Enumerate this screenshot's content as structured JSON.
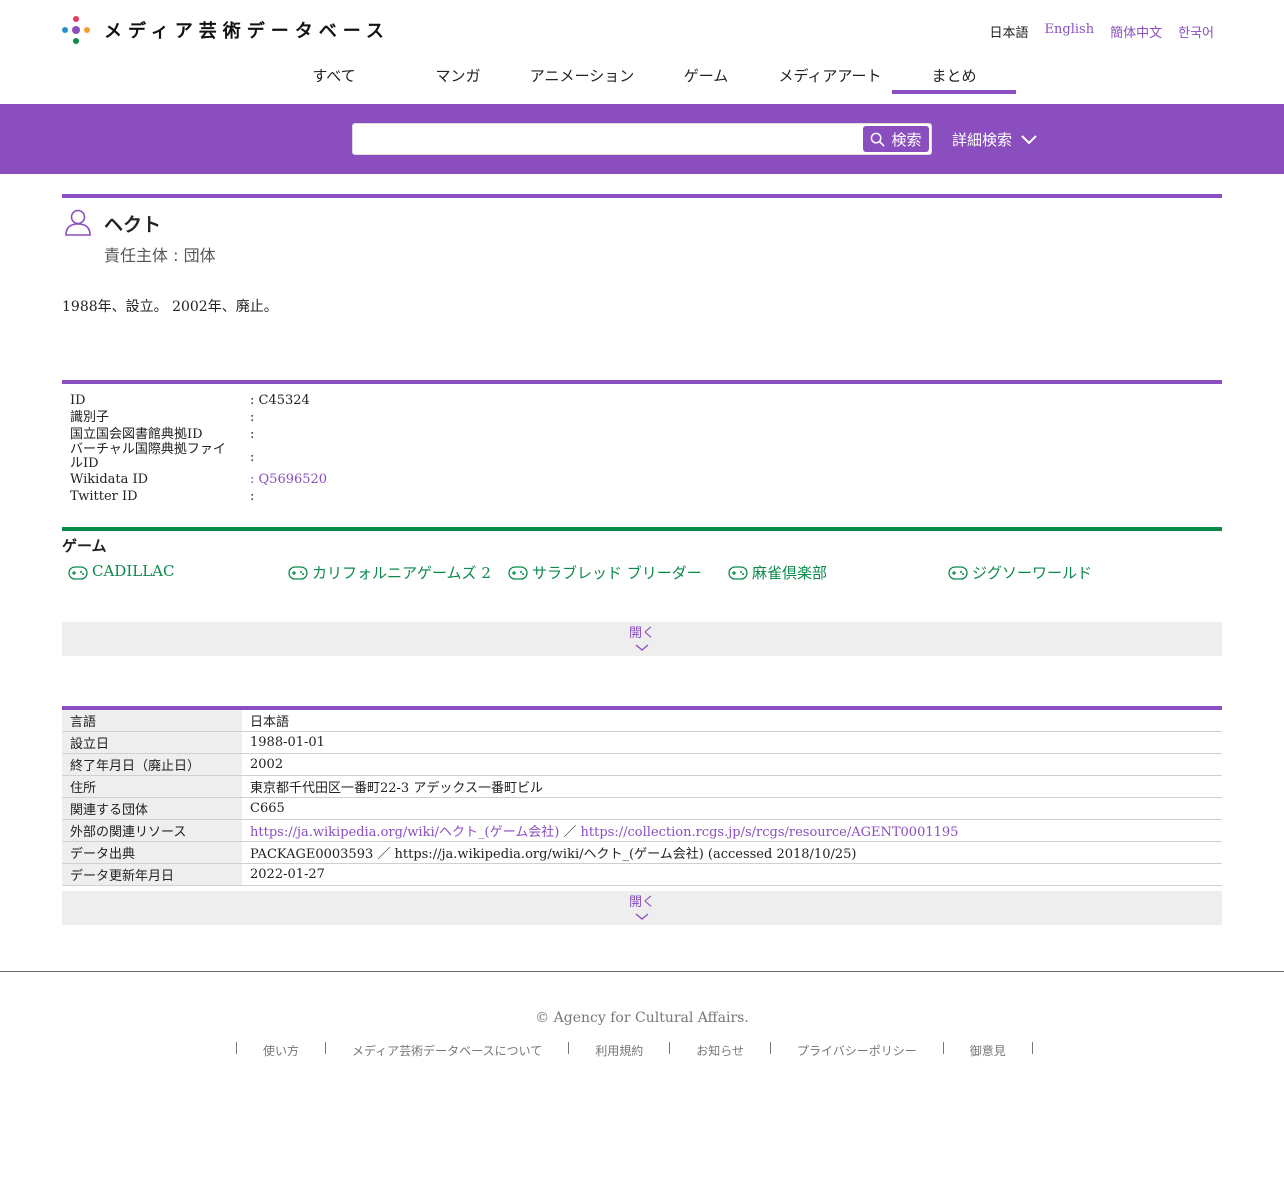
{
  "site": {
    "title": "メディア芸術データベース"
  },
  "languages": [
    {
      "label": "日本語"
    },
    {
      "label": "English"
    },
    {
      "label": "簡体中文"
    },
    {
      "label": "한국어"
    }
  ],
  "nav": [
    {
      "label": "すべて"
    },
    {
      "label": "マンガ"
    },
    {
      "label": "アニメーション"
    },
    {
      "label": "ゲーム"
    },
    {
      "label": "メディアアート"
    },
    {
      "label": "まとめ"
    }
  ],
  "search": {
    "button_label": "検索",
    "advanced_label": "詳細検索",
    "value": ""
  },
  "entity": {
    "name": "ヘクト",
    "type_label": "責任主体 : 団体",
    "description": "1988年、設立。 2002年、廃止。"
  },
  "identifiers": [
    {
      "key": "ID",
      "value": ": C45324"
    },
    {
      "key": "識別子",
      "value": ":"
    },
    {
      "key": "国立国会図書館典拠ID",
      "value": ":"
    },
    {
      "key": "バーチャル国際典拠ファイルID",
      "value": ":"
    },
    {
      "key": "Wikidata ID",
      "value": ": Q5696520"
    },
    {
      "key": "Twitter ID",
      "value": ":"
    }
  ],
  "games": {
    "section_title": "ゲーム",
    "items": [
      {
        "title": "CADILLAC"
      },
      {
        "title": "カリフォルニアゲームズ 2"
      },
      {
        "title": "サラブレッド ブリーダー"
      },
      {
        "title": "麻雀倶楽部"
      },
      {
        "title": "ジグソーワールド"
      }
    ],
    "open_label": "開く"
  },
  "metadata": {
    "rows": [
      {
        "key": "言語",
        "value": "日本語"
      },
      {
        "key": "設立日",
        "value": "1988-01-01"
      },
      {
        "key": "終了年月日（廃止日）",
        "value": "2002"
      },
      {
        "key": "住所",
        "value": "東京都千代田区一番町22-3 アデックス一番町ビル"
      },
      {
        "key": "関連する団体",
        "value": "C665"
      },
      {
        "key": "外部の関連リソース",
        "link1": "https://ja.wikipedia.org/wiki/ヘクト_(ゲーム会社)",
        "sep": " ／ ",
        "link2": "https://collection.rcgs.jp/s/rcgs/resource/AGENT0001195"
      },
      {
        "key": "データ出典",
        "value": "PACKAGE0003593 ／ https://ja.wikipedia.org/wiki/ヘクト_(ゲーム会社) (accessed 2018/10/25)"
      },
      {
        "key": "データ更新年月日",
        "value": "2022-01-27"
      }
    ],
    "open_label": "開く"
  },
  "footer": {
    "copyright": "© Agency for Cultural Affairs.",
    "links": [
      {
        "label": "使い方"
      },
      {
        "label": "メディア芸術データベースについて"
      },
      {
        "label": "利用規約"
      },
      {
        "label": "お知らせ"
      },
      {
        "label": "プライバシーポリシー"
      },
      {
        "label": "御意見"
      }
    ]
  },
  "colors": {
    "accent": "#8a4ebf",
    "game_green": "#0a8a4a"
  }
}
